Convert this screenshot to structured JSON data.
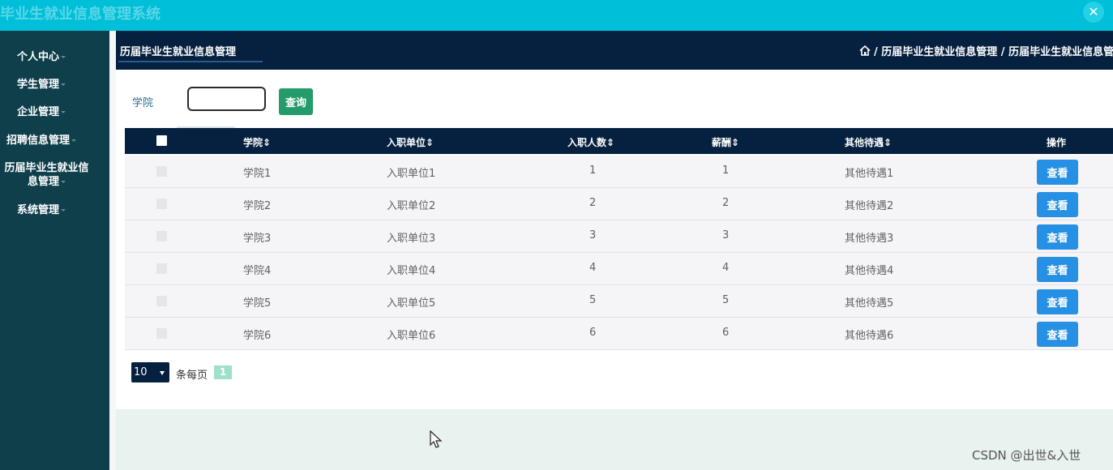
{
  "app": {
    "title": "毕业生就业信息管理系统",
    "close_icon": "close-icon"
  },
  "sidebar": {
    "items": [
      {
        "label": "个人中心"
      },
      {
        "label": "学生管理"
      },
      {
        "label": "企业管理"
      },
      {
        "label": "招聘信息管理"
      },
      {
        "label": "历届毕业生就业信息管理"
      },
      {
        "label": "系统管理"
      }
    ]
  },
  "header": {
    "tab": "历届毕业生就业信息管理",
    "breadcrumb": "/ 历届毕业生就业信息管理 / 历届毕业生就业信息管理"
  },
  "search": {
    "label": "学院",
    "value": "",
    "button": "查询"
  },
  "table": {
    "columns": [
      "学院",
      "入职单位",
      "入职人数",
      "薪酬",
      "其他待遇",
      "操作"
    ],
    "sort_marker": "⇕",
    "rows": [
      {
        "college": "学院1",
        "company": "入职单位1",
        "count": "1",
        "salary": "1",
        "benefits": "其他待遇1",
        "action": "查看"
      },
      {
        "college": "学院2",
        "company": "入职单位2",
        "count": "2",
        "salary": "2",
        "benefits": "其他待遇2",
        "action": "查看"
      },
      {
        "college": "学院3",
        "company": "入职单位3",
        "count": "3",
        "salary": "3",
        "benefits": "其他待遇3",
        "action": "查看"
      },
      {
        "college": "学院4",
        "company": "入职单位4",
        "count": "4",
        "salary": "4",
        "benefits": "其他待遇4",
        "action": "查看"
      },
      {
        "college": "学院5",
        "company": "入职单位5",
        "count": "5",
        "salary": "5",
        "benefits": "其他待遇5",
        "action": "查看"
      },
      {
        "college": "学院6",
        "company": "入职单位6",
        "count": "6",
        "salary": "6",
        "benefits": "其他待遇6",
        "action": "查看"
      }
    ]
  },
  "pagination": {
    "page_size": "10",
    "per_page_label": "条每页",
    "current_page": "1"
  },
  "watermark": "CSDN @出世&入世",
  "colors": {
    "topbar": "#00bfd8",
    "sidebar": "#0f3f4b",
    "header": "#06213f",
    "search_button": "#239b6a",
    "view_button": "#2590e4",
    "page_badge": "#9fe0c8"
  }
}
